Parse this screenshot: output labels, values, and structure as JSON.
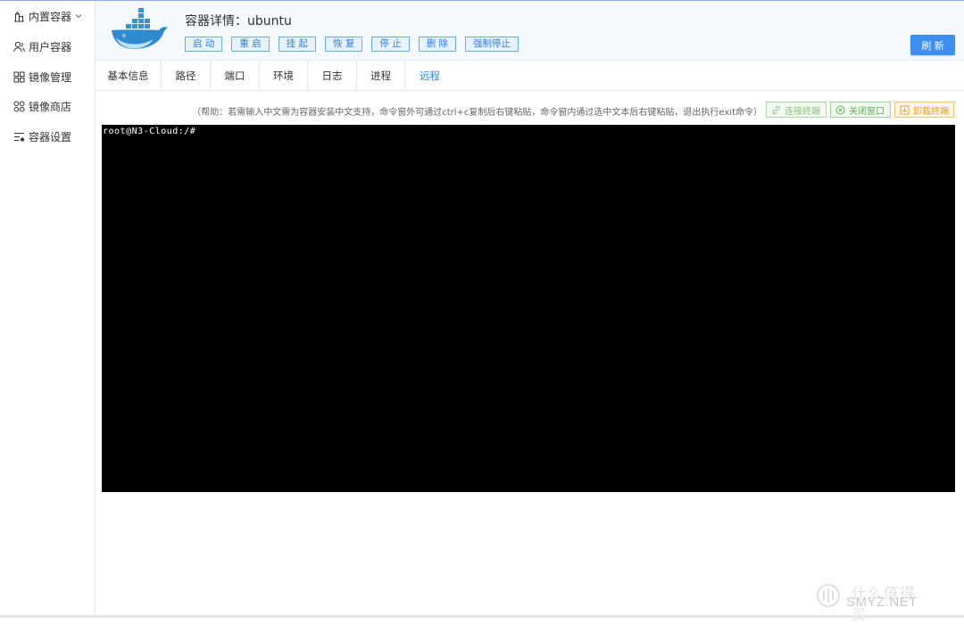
{
  "sidebar": {
    "items": [
      {
        "label": "内置容器",
        "icon": "building-icon",
        "expandable": true
      },
      {
        "label": "用户容器",
        "icon": "user-group-icon"
      },
      {
        "label": "镜像管理",
        "icon": "grid-icon"
      },
      {
        "label": "镜像商店",
        "icon": "apps-icon"
      },
      {
        "label": "容器设置",
        "icon": "settings-list-icon"
      }
    ]
  },
  "header": {
    "title": "容器详情：ubuntu",
    "actions": [
      "启 动",
      "重 启",
      "挂 起",
      "恢 复",
      "停 止",
      "删 除",
      "强制停止"
    ],
    "refresh_label": "刷 新"
  },
  "tabs": [
    {
      "label": "基本信息"
    },
    {
      "label": "路径"
    },
    {
      "label": "端口"
    },
    {
      "label": "环境"
    },
    {
      "label": "日志"
    },
    {
      "label": "进程"
    },
    {
      "label": "远程",
      "active": true
    }
  ],
  "toolbar": {
    "help": "（帮助：若需输入中文需为容器安装中文支持，命令窗外可通过ctrl+c复制后右键粘贴，命令窗内通过选中文本后右键粘贴，退出执行exit命令）",
    "connect_label": "连接终端",
    "close_label": "关闭窗口",
    "unload_label": "卸载终端"
  },
  "terminal": {
    "prompt": "root@N3-Cloud:/#"
  },
  "watermark": {
    "brand": "SMYZ.NET",
    "cn": "什么值得买"
  },
  "colors": {
    "accent": "#3d8eee",
    "tab_active": "#2d86ee",
    "connect": "#88c27c",
    "close": "#5fae56",
    "unload": "#e8a028",
    "terminal_bg": "#000000"
  }
}
